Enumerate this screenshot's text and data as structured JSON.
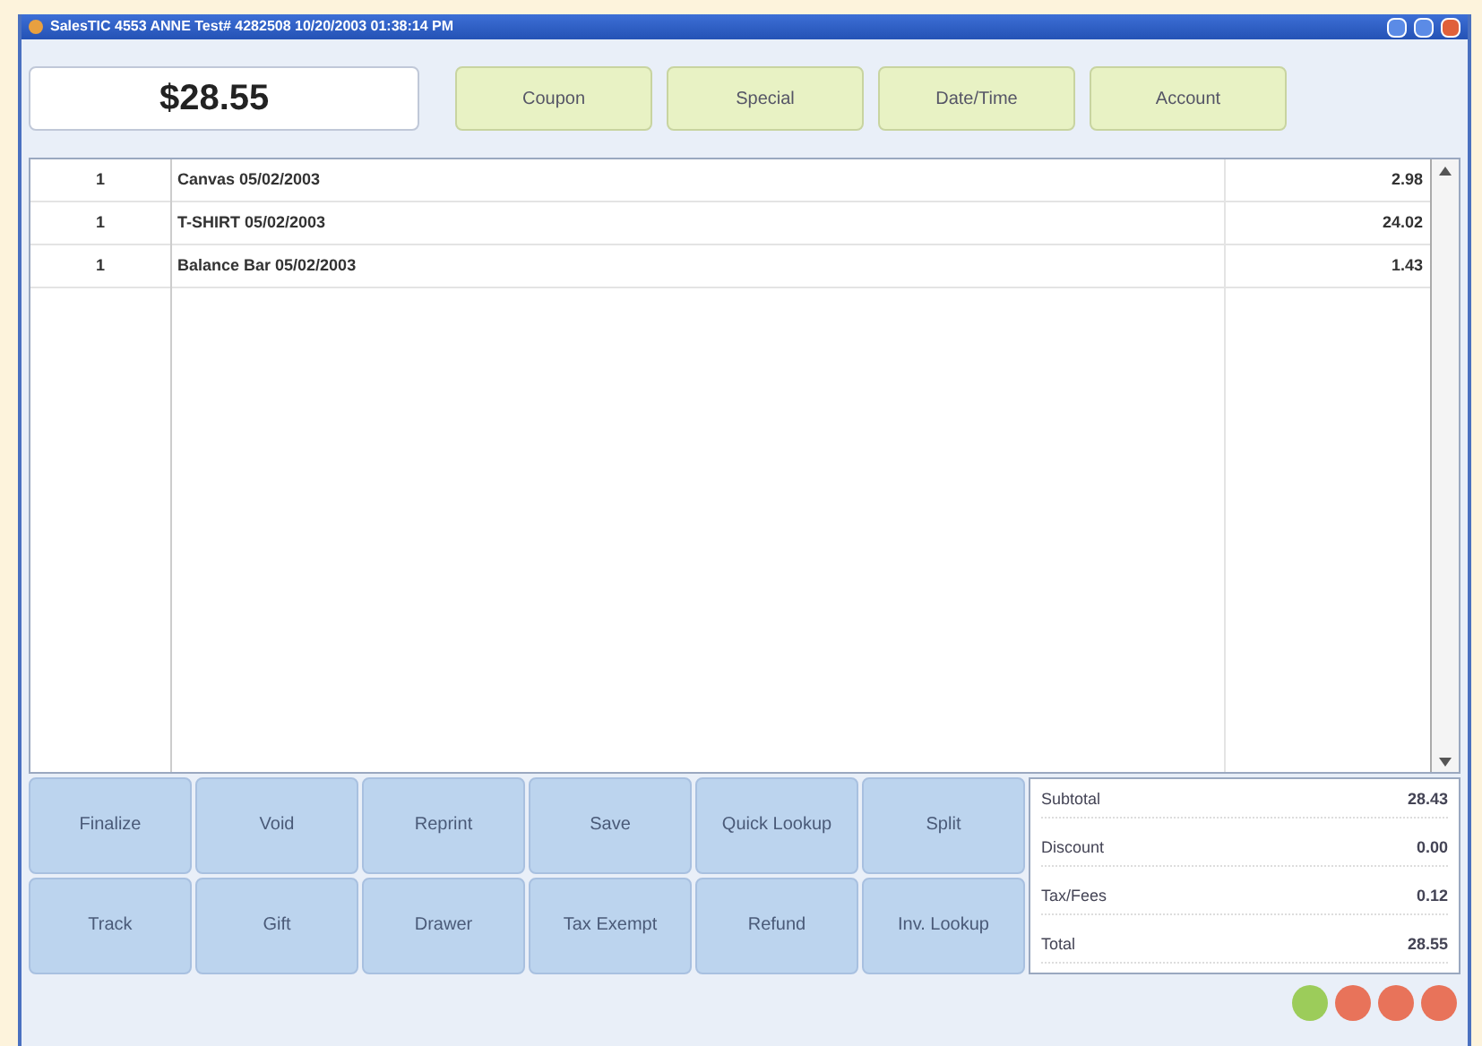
{
  "window": {
    "title": "SalesTIC   4553   ANNE   Test# 4282508   10/20/2003 01:38:14 PM"
  },
  "amount": "$28.55",
  "top_buttons": [
    "Coupon",
    "Special",
    "Date/Time",
    "Account"
  ],
  "items": [
    {
      "qty": "1",
      "description": "Canvas  05/02/2003",
      "price": "2.98"
    },
    {
      "qty": "1",
      "description": "T-SHIRT  05/02/2003",
      "price": "24.02"
    },
    {
      "qty": "1",
      "description": "Balance Bar  05/02/2003",
      "price": "1.43"
    }
  ],
  "action_buttons": [
    "Finalize",
    "Void",
    "Reprint",
    "Save",
    "Quick Lookup",
    "Split",
    "Track",
    "Gift",
    "Drawer",
    "Tax Exempt",
    "Refund",
    "Inv. Lookup"
  ],
  "totals": [
    {
      "label": "Subtotal",
      "value": "28.43"
    },
    {
      "label": "Discount",
      "value": "0.00"
    },
    {
      "label": "Tax/Fees",
      "value": "0.12"
    },
    {
      "label": "Total",
      "value": "28.55"
    }
  ],
  "status_lights": [
    {
      "color": "#9ccc5a"
    },
    {
      "color": "#e8735a"
    },
    {
      "color": "#e8735a"
    },
    {
      "color": "#e8735a"
    }
  ]
}
